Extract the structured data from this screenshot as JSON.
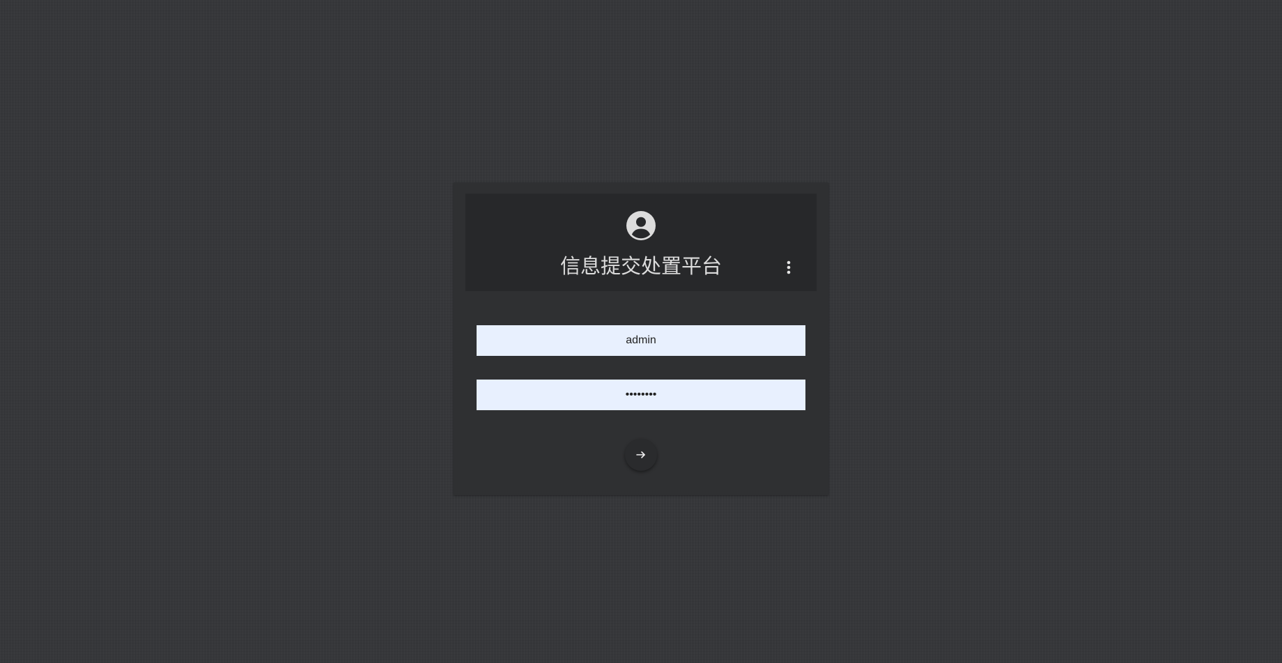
{
  "login": {
    "title": "信息提交处置平台",
    "username_value": "admin",
    "password_value": "12345678",
    "icons": {
      "avatar": "account-circle-icon",
      "more": "more-vertical-icon",
      "submit": "arrow-right-icon"
    },
    "colors": {
      "background": "#36373a",
      "card": "#2f3032",
      "header": "#27282a",
      "input_bg": "#e8f0fe",
      "title_text": "#dcdcdc"
    }
  }
}
